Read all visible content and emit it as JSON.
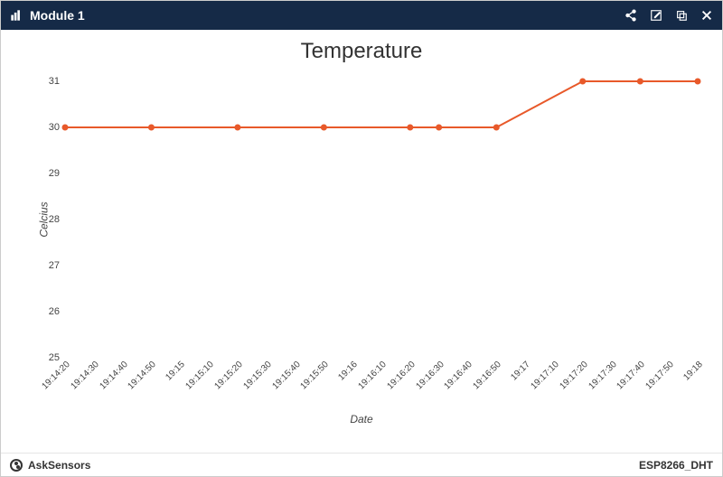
{
  "header": {
    "title": "Module 1",
    "icons": {
      "chart": "chart-icon",
      "share": "share-icon",
      "edit": "edit-icon",
      "copy": "copy-icon",
      "close": "close-icon"
    }
  },
  "footer": {
    "brand": "AskSensors",
    "device": "ESP8266_DHT"
  },
  "chart_data": {
    "type": "line",
    "title": "Temperature",
    "xlabel": "Date",
    "ylabel": "Celcius",
    "ylim": [
      25,
      31
    ],
    "yticks": [
      25,
      26,
      27,
      28,
      29,
      30,
      31
    ],
    "categories": [
      "19:14:20",
      "19:14:30",
      "19:14:40",
      "19:14:50",
      "19:15",
      "19:15:10",
      "19:15:20",
      "19:15:30",
      "19:15:40",
      "19:15:50",
      "19:16",
      "19:16:10",
      "19:16:20",
      "19:16:30",
      "19:16:40",
      "19:16:50",
      "19:17",
      "19:17:10",
      "19:17:20",
      "19:17:30",
      "19:17:40",
      "19:17:50",
      "19:18"
    ],
    "series": [
      {
        "name": "Temperature",
        "color": "#e8592a",
        "points": [
          {
            "x": "19:14:20",
            "y": 30
          },
          {
            "x": "19:14:50",
            "y": 30
          },
          {
            "x": "19:15:20",
            "y": 30
          },
          {
            "x": "19:15:50",
            "y": 30
          },
          {
            "x": "19:16:20",
            "y": 30
          },
          {
            "x": "19:16:30",
            "y": 30
          },
          {
            "x": "19:16:50",
            "y": 30
          },
          {
            "x": "19:17:20",
            "y": 31
          },
          {
            "x": "19:17:40",
            "y": 31
          },
          {
            "x": "19:18",
            "y": 31
          }
        ]
      }
    ]
  }
}
